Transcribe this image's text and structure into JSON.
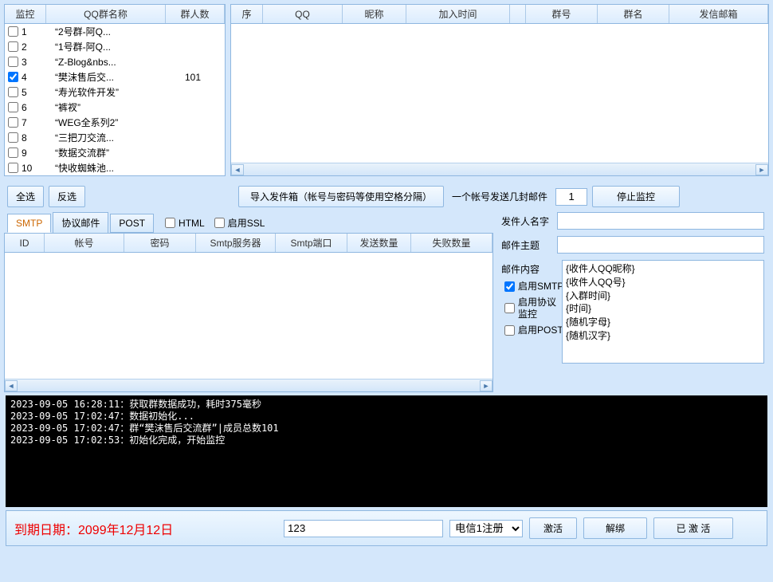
{
  "left_table": {
    "headers": [
      "监控",
      "QQ群名称",
      "群人数"
    ],
    "rows": [
      {
        "idx": "1",
        "name": "“2号群-阿Q...",
        "count": "",
        "checked": false
      },
      {
        "idx": "2",
        "name": "“1号群-阿Q...",
        "count": "",
        "checked": false
      },
      {
        "idx": "3",
        "name": "“Z-Blog&nbs...",
        "count": "",
        "checked": false
      },
      {
        "idx": "4",
        "name": "“樊沫售后交...",
        "count": "101",
        "checked": true
      },
      {
        "idx": "5",
        "name": "“寿光软件开发”",
        "count": "",
        "checked": false
      },
      {
        "idx": "6",
        "name": "“裤衩”",
        "count": "",
        "checked": false
      },
      {
        "idx": "7",
        "name": "“WEG全系列2”",
        "count": "",
        "checked": false
      },
      {
        "idx": "8",
        "name": "“三把刀交流...",
        "count": "",
        "checked": false
      },
      {
        "idx": "9",
        "name": "“数据交流群”",
        "count": "",
        "checked": false
      },
      {
        "idx": "10",
        "name": "“快收蜘蛛池...",
        "count": "",
        "checked": false
      }
    ]
  },
  "right_table": {
    "headers": [
      "序",
      "QQ",
      "昵称",
      "加入时间",
      "",
      "群号",
      "群名",
      "发信邮箱"
    ]
  },
  "buttons": {
    "select_all": "全选",
    "invert": "反选",
    "import_sender": "导入发件箱（帐号与密码等使用空格分隔）",
    "per_account_label": "一个帐号发送几封邮件",
    "per_account_value": "1",
    "stop_monitor": "停止监控"
  },
  "tabs": {
    "smtp": "SMTP",
    "proto": "协议邮件",
    "post": "POST",
    "html_chk": "HTML",
    "ssl_chk": "启用SSL"
  },
  "cfg_headers": [
    "ID",
    "帐号",
    "密码",
    "Smtp服务器",
    "Smtp端口",
    "发送数量",
    "失败数量"
  ],
  "form": {
    "sender_name": "发件人名字",
    "subject": "邮件主题",
    "content": "邮件内容",
    "content_value": "{收件人QQ昵称}\n{收件人QQ号}\n{入群时间}\n{时间}\n{随机字母}\n{随机汉字}",
    "enable_smtp": "启用SMTP",
    "enable_proto": "启用协议监控",
    "enable_post": "启用POST"
  },
  "console_lines": [
    "2023-09-05 16:28:11：获取群数据成功，耗时375毫秒",
    "2023-09-05 17:02:47：数据初始化...",
    "2023-09-05 17:02:47：群“樊沫售后交流群”|成员总数101",
    "2023-09-05 17:02:53：初始化完成，开始监控"
  ],
  "bottom": {
    "expire": "到期日期：2099年12月12日",
    "code": "123",
    "line_sel": "电信1注册",
    "activate": "激活",
    "unbind": "解绑",
    "activated": "已 激 活"
  }
}
